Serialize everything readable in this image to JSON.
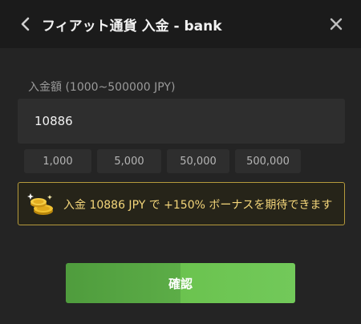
{
  "header": {
    "title": "フィアット通貨 入金 - bank",
    "back_icon": "chevron-left-icon",
    "close_icon": "close-icon"
  },
  "amount": {
    "label": "入金額 (1000~500000 JPY)",
    "value": "10886"
  },
  "presets": [
    "1,000",
    "5,000",
    "50,000",
    "500,000"
  ],
  "bonus": {
    "icon": "gold-coins-icon",
    "text": "入金 10886 JPY で +150% ボーナスを期待できます"
  },
  "confirm_label": "確認",
  "colors": {
    "background": "#242424",
    "header": "#1b1b1b",
    "field": "#2e2e2e",
    "bonus_border": "#b59a3c",
    "bonus_text": "#f4d67a",
    "accent_green": "#6bc34f"
  }
}
